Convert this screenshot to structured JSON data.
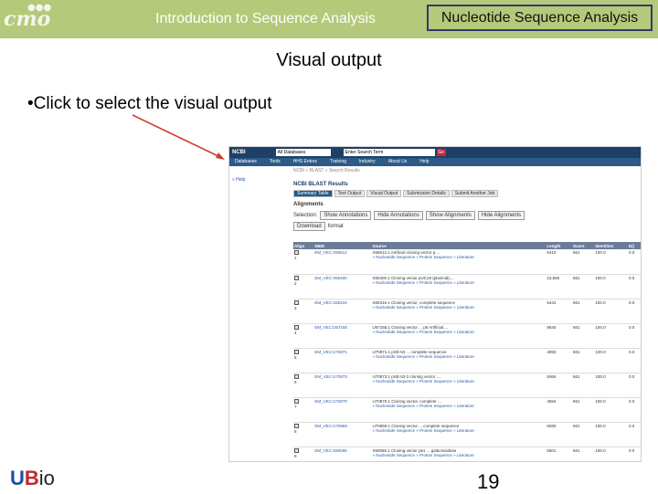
{
  "header": {
    "logo_text": "cmo",
    "deck_title": "Introduction to Sequence Analysis",
    "section_tag": "Nucleotide Sequence Analysis",
    "bar_color": "#b5c97a"
  },
  "slide": {
    "title": "Visual output",
    "bullet": "•Click to select the visual output",
    "page_number": "19"
  },
  "footer_logo": {
    "u": "U",
    "b": "B",
    "io": "io"
  },
  "screenshot": {
    "site": "NCBI",
    "database": "All Databases",
    "search_placeholder": "Enter Search Term",
    "go_label": "Go",
    "nav": [
      "Databases",
      "Tools",
      "HHS Entrez",
      "Training",
      "Industry",
      "About Us",
      "Help"
    ],
    "breadcrumb": "NCBI » BLAST » Search Results",
    "help_link": "» Help",
    "subtitle": "NCBI BLAST Results",
    "tabs": [
      "Summary Table",
      "Text Output",
      "Visual Output",
      "Submission Details",
      "Submit Another Job"
    ],
    "active_tab": 0,
    "alignments_label": "Alignments",
    "selection_label": "Selection:",
    "buttons": {
      "show_annotations": "Show Annotations",
      "hide_annotations": "Hide Annotations",
      "show_alignments": "Show Alignments",
      "hide_alignments": "Hide Alignments",
      "download": "Download",
      "format": "format"
    },
    "columns": [
      "Align",
      "DBID",
      "Source",
      "Length",
      "Score",
      "Identities",
      "E()"
    ],
    "rows": [
      {
        "n": "1",
        "id": "EM_VEC:X66612",
        "src": "X66612.1 Artificial cloning vector p....",
        "len": "5410",
        "score": "661",
        "ident": "100.0",
        "e": "0.0"
      },
      {
        "n": "2",
        "id": "EM_VEC:X65300",
        "src": "X65300.1 Cloning vector pUC19 (plasmid)....",
        "len": "10,555",
        "score": "661",
        "ident": "100.0",
        "e": "0.0"
      },
      {
        "n": "3",
        "id": "EM_VEC:X65316",
        "src": "X65316.1 Cloning vector, complete sequence",
        "len": "5431",
        "score": "661",
        "ident": "100.0",
        "e": "0.0"
      },
      {
        "n": "4",
        "id": "EM_VEC:U57165",
        "src": "U57165.1 Cloning vector ... p6 Artificial....",
        "len": "8840",
        "score": "661",
        "ident": "100.0",
        "e": "0.0"
      },
      {
        "n": "5",
        "id": "EM_VEC:U70871",
        "src": "U70871.1 pSE-53 ... complete sequence",
        "len": "4893",
        "score": "661",
        "ident": "100.0",
        "e": "0.0"
      },
      {
        "n": "6",
        "id": "EM_VEC:U70873",
        "src": "U70873.1 pSE-53-2 cloning vector ....",
        "len": "5066",
        "score": "661",
        "ident": "100.0",
        "e": "0.0"
      },
      {
        "n": "7",
        "id": "EM_VEC:U70870",
        "src": "U70870.1 Cloning vector, complete ....",
        "len": "4894",
        "score": "661",
        "ident": "100.0",
        "e": "0.0"
      },
      {
        "n": "8",
        "id": "EM_VEC:U70869",
        "src": "U70869.1 Cloning vector ... complete sequence",
        "len": "5080",
        "score": "661",
        "ident": "100.0",
        "e": "0.0"
      },
      {
        "n": "9",
        "id": "EM_VEC:X60065",
        "src": "X60065.1 Cloning vector p51 ... galactosidase",
        "len": "5601",
        "score": "661",
        "ident": "100.0",
        "e": "0.0"
      }
    ],
    "row_links": "» Nucleotide Sequence  » Protein Sequence  » Literature"
  }
}
